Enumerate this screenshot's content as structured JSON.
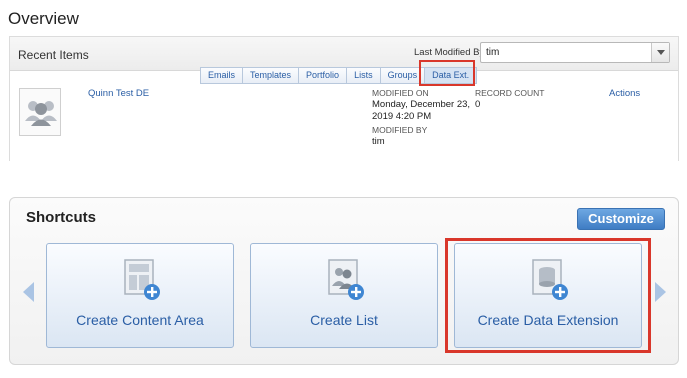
{
  "page": {
    "title": "Overview"
  },
  "recent_items": {
    "title": "Recent Items",
    "filter_label": "Last Modified By",
    "filter_value": "tim",
    "tabs": [
      {
        "label": "Emails"
      },
      {
        "label": "Templates"
      },
      {
        "label": "Portfolio"
      },
      {
        "label": "Lists"
      },
      {
        "label": "Groups"
      },
      {
        "label": "Data Ext."
      }
    ],
    "active_tab": "Data Ext.",
    "items": [
      {
        "name": "Quinn Test DE",
        "modified_on_label": "MODIFIED ON",
        "modified_on_line1": "Monday, December 23,",
        "modified_on_line2": "2019 4:20 PM",
        "modified_by_label": "MODIFIED BY",
        "modified_by": "tim",
        "record_count_label": "RECORD COUNT",
        "record_count": "0",
        "actions_label": "Actions"
      }
    ]
  },
  "shortcuts": {
    "title": "Shortcuts",
    "customize_label": "Customize",
    "cards": [
      {
        "label": "Create Content Area",
        "icon": "content-area-icon"
      },
      {
        "label": "Create List",
        "icon": "list-icon"
      },
      {
        "label": "Create Data Extension",
        "icon": "data-extension-icon"
      }
    ]
  },
  "colors": {
    "link": "#2a5ea5",
    "highlight": "#d9372b",
    "customize_button": "#4f8ed4"
  }
}
